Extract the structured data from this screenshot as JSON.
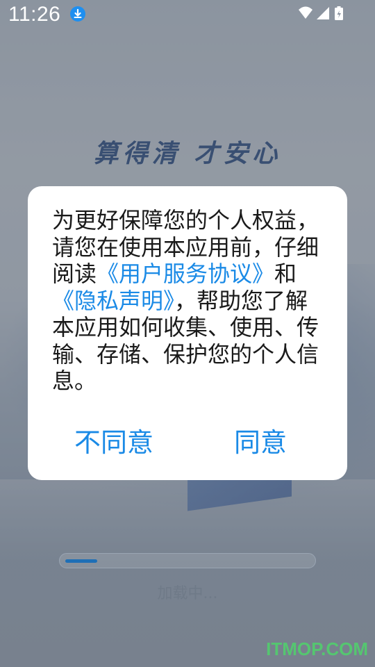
{
  "status_bar": {
    "time": "11:26"
  },
  "background": {
    "slogan": "算得清 才安心"
  },
  "dialog": {
    "text_part1": "为更好保障您的个人权益，请您在使用本应用前，仔细阅读",
    "link_user_agreement": "《用户服务协议》",
    "text_and": "和",
    "link_privacy": "《隐私声明》",
    "text_part2": "，帮助您了解本应用如何收集、使用、传输、存储、保护您的个人信息。",
    "decline_label": "不同意",
    "agree_label": "同意"
  },
  "loading": {
    "text": "加载中...",
    "progress": 0.1
  },
  "watermark": "ITMOP.COM",
  "colors": {
    "accent": "#1a8ae6",
    "progress": "#1e6fb6",
    "watermark": "#4fd36b"
  }
}
